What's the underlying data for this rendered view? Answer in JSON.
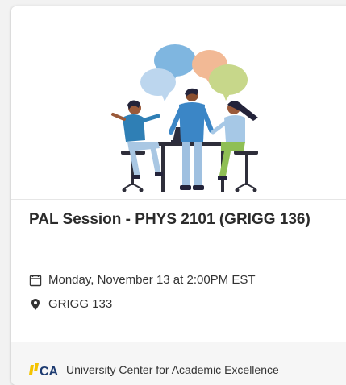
{
  "event": {
    "title": "PAL Session - PHYS 2101 (GRIGG 136)",
    "date_time": "Monday, November 13 at 2:00PM EST",
    "location": "GRIGG 133"
  },
  "host": {
    "organization": "University Center for Academic Excellence",
    "logo_text": "CA"
  },
  "icons": {
    "date": "calendar-icon",
    "location": "map-pin-icon",
    "illustration": "group-discussion-illustration"
  },
  "colors": {
    "title_text": "#2b2b2b",
    "body_text": "#333333",
    "logo_accent": "#f4c300",
    "logo_text": "#1c3a70"
  }
}
